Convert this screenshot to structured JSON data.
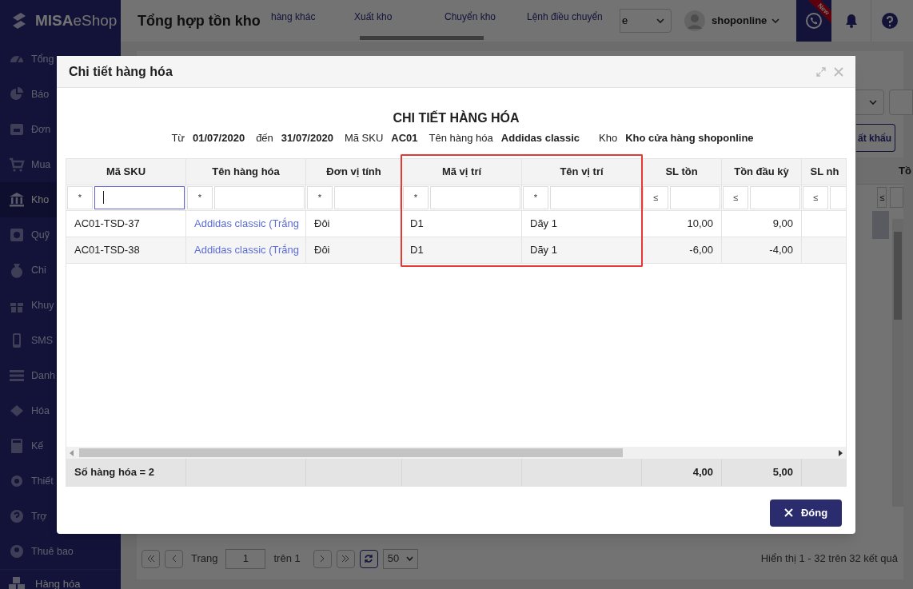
{
  "sidebar": {
    "logo": "**MISA**eShop",
    "items": [
      {
        "label": "Tổng",
        "selected": false
      },
      {
        "label": "Báo",
        "selected": false
      },
      {
        "label": "Đơn",
        "selected": false
      },
      {
        "label": "Mua",
        "selected": false
      },
      {
        "label": "Kho",
        "selected": true
      },
      {
        "label": "Quỹ",
        "selected": false
      },
      {
        "label": "Chi",
        "selected": false
      },
      {
        "label": "Khuy",
        "selected": false
      },
      {
        "label": "SMS",
        "selected": false
      },
      {
        "label": "Danh",
        "selected": false
      },
      {
        "label": "Hóa",
        "selected": false
      },
      {
        "label": "Kế",
        "selected": false
      },
      {
        "label": "Thiết",
        "selected": false
      },
      {
        "label": "Trợ",
        "selected": false
      },
      {
        "label": "Thuê bao",
        "selected": false
      }
    ],
    "bottom_item": "Hàng hóa"
  },
  "header": {
    "title": "Tổng hợp tồn kho",
    "tabs": [
      "hàng khác",
      "Xuất kho",
      "Chuyển kho",
      "Lệnh điều chuyển"
    ],
    "store_select": "e",
    "user": "shoponline",
    "badge": "New"
  },
  "toolbar": {
    "export_button": "ất khẩu"
  },
  "grid": {
    "column_header": "Tồ",
    "filter_op": "≤"
  },
  "pager": {
    "page_label": "Trang",
    "page": "1",
    "of_label": "trên 1",
    "page_size": "50",
    "summary": "Hiển thị 1 - 32 trên 32 kết quả"
  },
  "modal": {
    "title": "Chi tiết hàng hóa",
    "report_title": "CHI TIẾT HÀNG HÓA",
    "filters": [
      {
        "label": "Từ",
        "value": "01/07/2020"
      },
      {
        "label": "đến",
        "value": "31/07/2020"
      },
      {
        "label": "Mã SKU",
        "value": "AC01"
      },
      {
        "label": "Tên hàng hóa",
        "value": "Addidas classic"
      },
      {
        "label": "Kho",
        "value": "Kho cửa hàng shoponline"
      }
    ],
    "table": {
      "columns": [
        {
          "header": "Mã SKU",
          "kind": "text",
          "filter_op": "*",
          "focused": true,
          "highlighted": false
        },
        {
          "header": "Tên hàng hóa",
          "kind": "link",
          "filter_op": "*",
          "focused": false,
          "highlighted": false
        },
        {
          "header": "Đơn vị tính",
          "kind": "text",
          "filter_op": "*",
          "focused": false,
          "highlighted": false
        },
        {
          "header": "Mã vị trí",
          "kind": "text",
          "filter_op": "*",
          "focused": false,
          "highlighted": true
        },
        {
          "header": "Tên vị trí",
          "kind": "text",
          "filter_op": "*",
          "focused": false,
          "highlighted": true
        },
        {
          "header": "SL tồn",
          "kind": "number",
          "filter_op": "≤",
          "focused": false,
          "highlighted": false,
          "total": "4,00"
        },
        {
          "header": "Tồn đầu kỳ",
          "kind": "number",
          "filter_op": "≤",
          "focused": false,
          "highlighted": false,
          "total": "5,00"
        },
        {
          "header": "SL nh",
          "kind": "number",
          "filter_op": "≤",
          "focused": false,
          "highlighted": false
        }
      ],
      "rows": [
        [
          "AC01-TSD-37",
          "Addidas classic (Trắng",
          "Đôi",
          "D1",
          "Dãy 1",
          "10,00",
          "9,00"
        ],
        [
          "AC01-TSD-38",
          "Addidas classic (Trắng",
          "Đôi",
          "D1",
          "Dãy 1",
          "-6,00",
          "-4,00"
        ]
      ],
      "footer_label": "Số hàng hóa = 2"
    },
    "close_button": "Đóng"
  }
}
